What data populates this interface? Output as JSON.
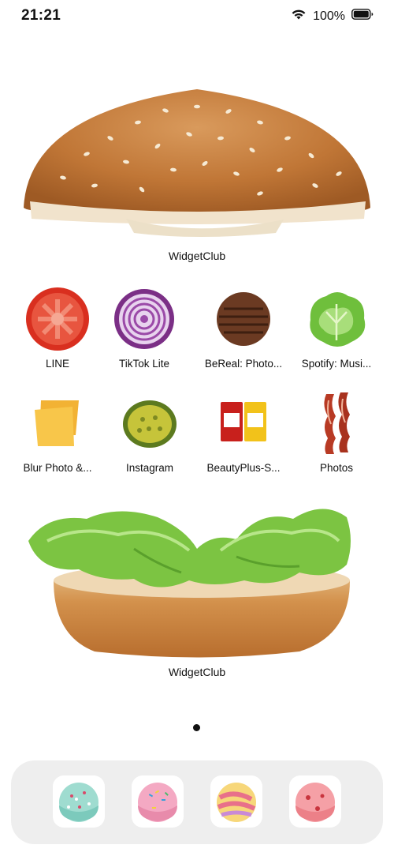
{
  "status_bar": {
    "time": "21:21",
    "battery_percent": "100%",
    "icons": [
      "wifi-icon",
      "battery-icon"
    ]
  },
  "widgets": [
    {
      "label": "WidgetClub",
      "image": "burger-top-bun-image"
    },
    {
      "label": "WidgetClub",
      "image": "burger-bottom-bun-lettuce-image"
    }
  ],
  "apps": [
    {
      "label": "LINE",
      "icon": "tomato-slice-icon"
    },
    {
      "label": "TikTok Lite",
      "icon": "red-onion-icon"
    },
    {
      "label": "BeReal: Photo...",
      "icon": "burger-patty-icon"
    },
    {
      "label": "Spotify: Musi...",
      "icon": "lettuce-icon"
    },
    {
      "label": "Blur Photo &...",
      "icon": "cheese-slice-icon"
    },
    {
      "label": "Instagram",
      "icon": "pickle-slice-icon"
    },
    {
      "label": "BeautyPlus-S...",
      "icon": "sauce-packets-icon"
    },
    {
      "label": "Photos",
      "icon": "bacon-strips-icon"
    }
  ],
  "dock": {
    "apps": [
      {
        "icon": "mint-ice-cream-icon"
      },
      {
        "icon": "pink-sprinkle-ice-cream-icon"
      },
      {
        "icon": "swirl-ice-cream-icon"
      },
      {
        "icon": "strawberry-ice-cream-icon"
      }
    ]
  },
  "colors": {
    "background": "#ffffff",
    "dock_background": "#eeeeee",
    "text": "#111111"
  }
}
